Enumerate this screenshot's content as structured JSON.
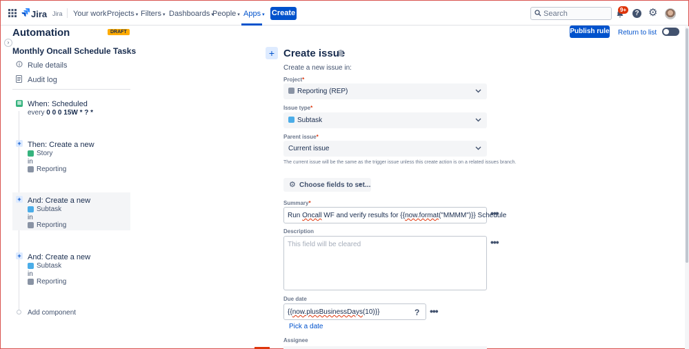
{
  "topnav": {
    "product": "Jira",
    "product_secondary": "Jira",
    "items": [
      "Your work",
      "Projects",
      "Filters",
      "Dashboards",
      "People",
      "Apps"
    ],
    "create_label": "Create",
    "search_placeholder": "Search",
    "notifications_badge": "9+"
  },
  "sidebar": {
    "title": "Automation",
    "draft_label": "DRAFT",
    "rule_name": "Monthly Oncall Schedule Tasks",
    "links": [
      "Rule details",
      "Audit log"
    ],
    "steps": [
      {
        "title": "When: Scheduled",
        "detail_prefix": "every",
        "detail_value": "0 0 0 15W * ? *"
      },
      {
        "title": "Then: Create a new",
        "type": "Story",
        "in": "in",
        "project": "Reporting"
      },
      {
        "title": "And: Create a new",
        "type": "Subtask",
        "in": "in",
        "project": "Reporting"
      },
      {
        "title": "And: Create a new",
        "type": "Subtask",
        "in": "in",
        "project": "Reporting"
      }
    ],
    "add_component": "Add component"
  },
  "actions": {
    "publish": "Publish rule",
    "return": "Return to list"
  },
  "form": {
    "title": "Create issue",
    "subtitle": "Create a new issue in:",
    "project_label": "Project",
    "project_value": "Reporting (REP)",
    "issue_type_label": "Issue type",
    "issue_type_value": "Subtask",
    "parent_label": "Parent issue",
    "parent_value": "Current issue",
    "parent_help": "The current issue will be the same as the trigger issue unless this create action is on a related issues branch.",
    "choose_fields": "Choose fields to set...",
    "summary_label": "Summary",
    "summary_value": {
      "a": "Run ",
      "b": "Oncall",
      "c": " WF and verify results for {{",
      "d": "now.format",
      "e": "(\"MMMM\")}} Schedule"
    },
    "description_label": "Description",
    "description_placeholder": "This field will be cleared",
    "due_label": "Due date",
    "due_value": {
      "a": "{{",
      "b": "now.plusBusinessDays",
      "c": "(10)}}"
    },
    "pick_date": "Pick a date",
    "assignee_label": "Assignee"
  },
  "colors": {
    "brand": "#0052CC",
    "draft": "#FFAB00",
    "story": "#36B37E",
    "subtask": "#4BADE8",
    "badge": "#DE350B"
  }
}
